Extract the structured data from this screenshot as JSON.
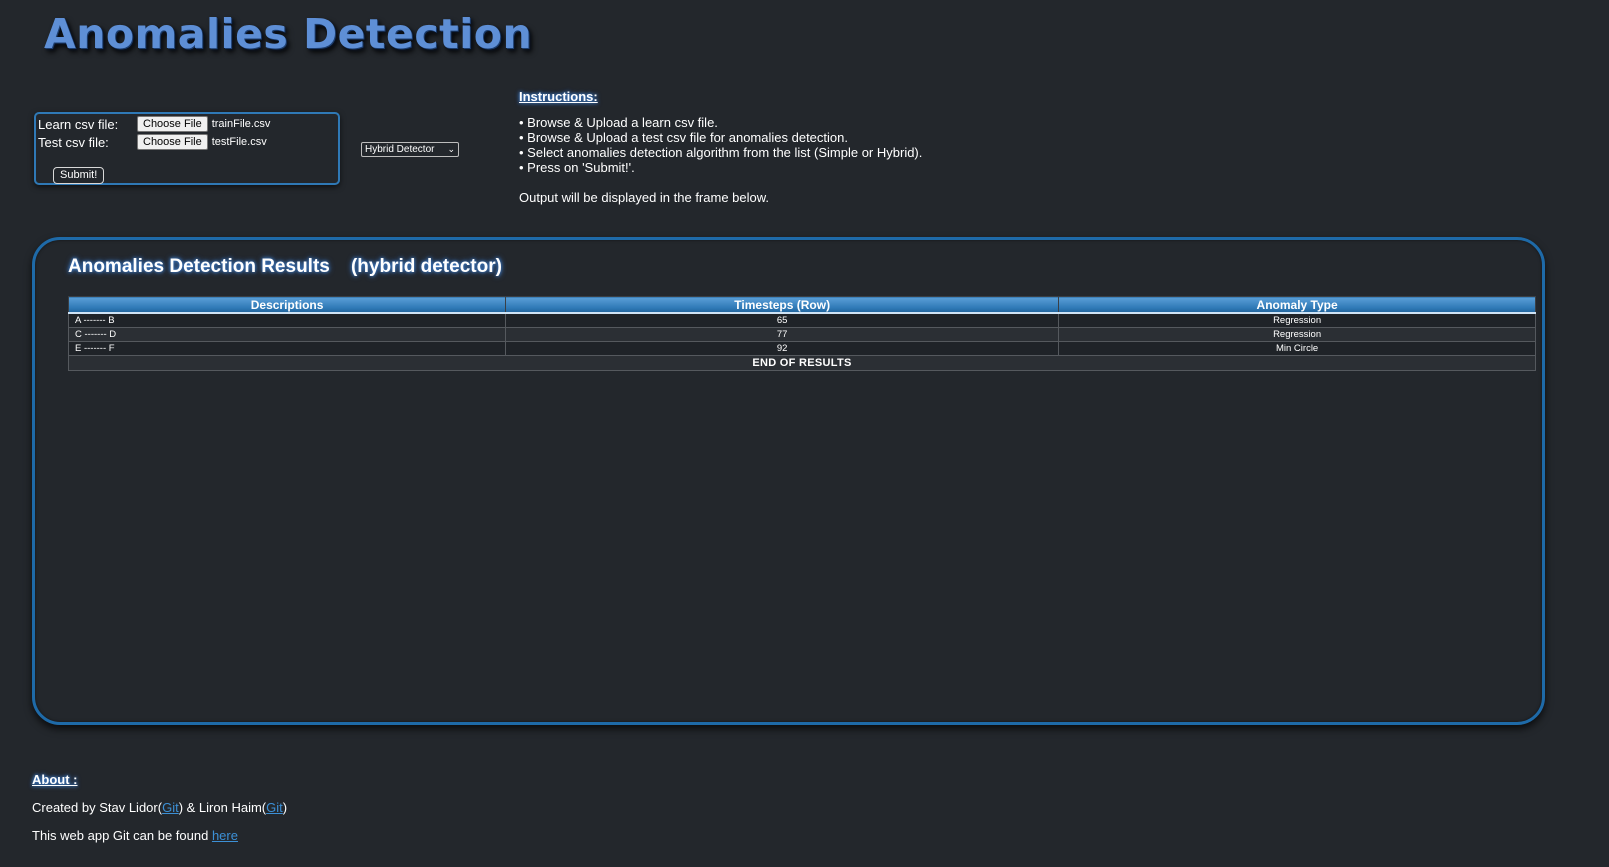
{
  "header": {
    "title": "Anomalies Detection"
  },
  "upload": {
    "learn_label": "Learn csv file:",
    "learn_button": "Choose File",
    "learn_file": "trainFile.csv",
    "test_label": "Test csv file:",
    "test_button": "Choose File",
    "test_file": "testFile.csv",
    "submit_label": "Submit!"
  },
  "algorithm": {
    "selected": "Hybrid Detector"
  },
  "instructions": {
    "heading": "Instructions:",
    "items": [
      "• Browse & Upload a learn csv file.",
      "• Browse & Upload a test csv file for anomalies detection.",
      "• Select anomalies detection algorithm from the list (Simple or Hybrid).",
      "• Press on 'Submit!'."
    ],
    "output_note": "Output will be displayed in the frame below."
  },
  "results": {
    "title": "Anomalies Detection Results    (hybrid detector)",
    "columns": [
      "Descriptions",
      "Timesteps (Row)",
      "Anomaly Type"
    ],
    "rows": [
      [
        "A ------- B",
        "65",
        "Regression"
      ],
      [
        "C ------- D",
        "77",
        "Regression"
      ],
      [
        "E ------- F",
        "92",
        "Min Circle"
      ]
    ],
    "end_label": "END OF RESULTS"
  },
  "about": {
    "heading": "About :",
    "credit_prefix": "Created by Stav Lidor(",
    "credit_link1": "Git",
    "credit_middle": ") & Liron Haim(",
    "credit_link2": "Git",
    "credit_suffix": ")",
    "repo_prefix": "This web app Git can be found ",
    "repo_link": "here"
  },
  "colors": {
    "background": "#23272c",
    "accent_blue": "#2f79b6",
    "title_blue": "#5e8fd6",
    "link": "#3c90d6"
  }
}
